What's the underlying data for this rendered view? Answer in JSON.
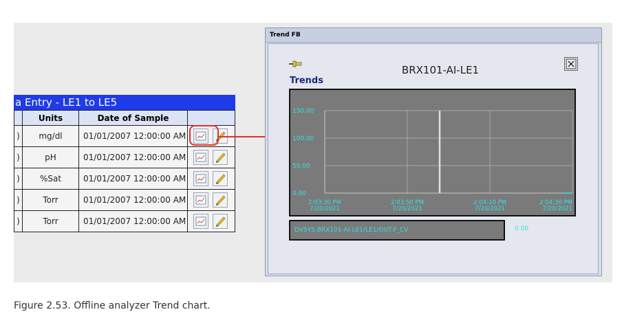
{
  "table": {
    "title": "a Entry - LE1 to LE5",
    "headers": [
      "",
      "Units",
      "Date of Sample",
      ""
    ],
    "rows": [
      {
        "lead": ")",
        "units": "mg/dl",
        "date": "01/01/2007 12:00:00 AM"
      },
      {
        "lead": ")",
        "units": "pH",
        "date": "01/01/2007 12:00:00 AM"
      },
      {
        "lead": ")",
        "units": "%Sat",
        "date": "01/01/2007 12:00:00 AM"
      },
      {
        "lead": ")",
        "units": "Torr",
        "date": "01/01/2007 12:00:00 AM"
      },
      {
        "lead": ")",
        "units": "Torr",
        "date": "01/01/2007 12:00:00 AM"
      }
    ]
  },
  "window": {
    "title": "Trend FB",
    "tag": "BRX101-AI-LE1",
    "section": "Trends",
    "pen_label": "DVSYS.BRX101-AI-LE1/LE1/OUT.F_CV",
    "pen_value": "0.00"
  },
  "chart_data": {
    "type": "line",
    "ylim": [
      0,
      150
    ],
    "yticks": [
      "150.00",
      "100.00",
      "50.00",
      "0.00"
    ],
    "xticks": [
      {
        "time": "2:03:30 PM",
        "date": "7/20/2021"
      },
      {
        "time": "2:03:50 PM",
        "date": "7/20/2021"
      },
      {
        "time": "2:04:10 PM",
        "date": "7/20/2021"
      },
      {
        "time": "2:04:30 PM",
        "date": "7/20/2021"
      }
    ],
    "grid": true,
    "series": [
      {
        "values": [
          0.0
        ]
      }
    ]
  },
  "caption": "Figure 2.53.  Offline analyzer Trend chart.",
  "colors": {
    "accent_blue": "#1f3ae8",
    "trace_cyan": "#35e0e5",
    "highlight_red": "#e03030"
  }
}
